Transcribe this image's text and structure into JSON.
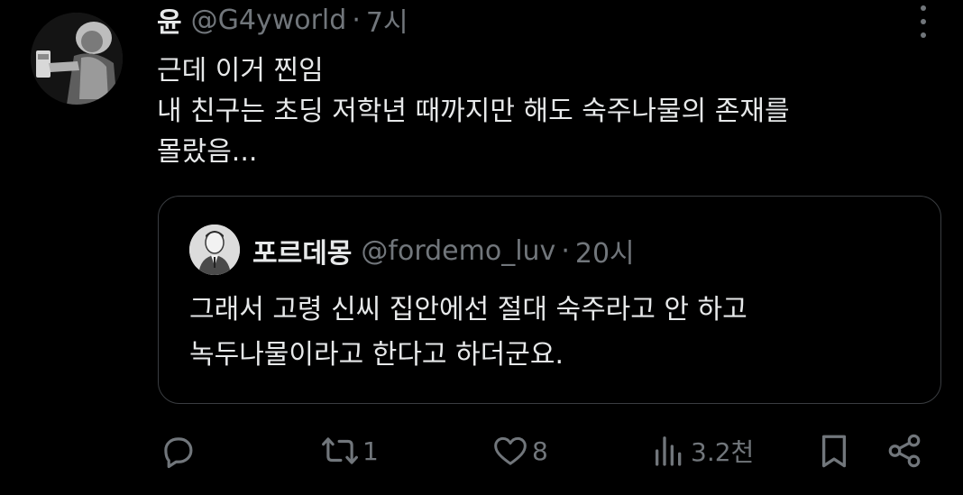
{
  "tweet": {
    "display_name": "윤",
    "handle": "@G4yworld",
    "separator": "·",
    "time": "7시",
    "text_lines": [
      "근데 이거 찐임",
      "내 친구는 초딩 저학년 때까지만 해도 숙주나물의 존재를",
      "몰랐음..."
    ]
  },
  "quote": {
    "display_name": "포르데몽",
    "handle": "@fordemo_luv",
    "separator": "·",
    "time": "20시",
    "text_lines": [
      "그래서 고령 신씨 집안에선 절대 숙주라고 안 하고",
      "녹두나물이라고 한다고 하더군요."
    ]
  },
  "actions": {
    "reply_icon": "reply-icon",
    "retweet_icon": "retweet-icon",
    "retweet_count": "1",
    "like_icon": "heart-icon",
    "like_count": "8",
    "views_icon": "views-icon",
    "views_count": "3.2천",
    "bookmark_icon": "bookmark-icon",
    "share_icon": "share-icon"
  },
  "colors": {
    "background": "#000000",
    "primary_text": "#e7e9ea",
    "secondary_text": "#71767b",
    "border": "#3a3d41"
  }
}
